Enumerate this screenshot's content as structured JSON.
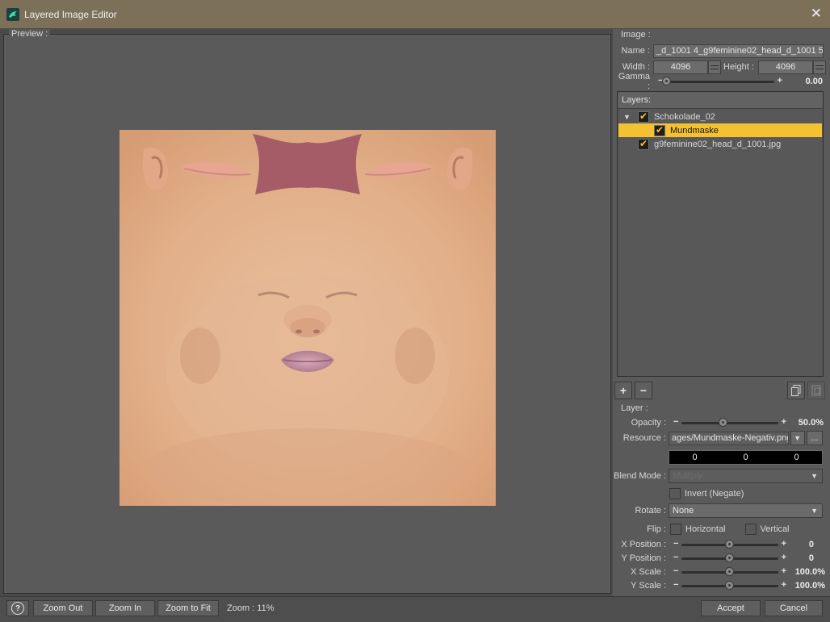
{
  "window": {
    "title": "Layered Image Editor",
    "close_symbol": "✕",
    "app_icon": "daz-dragon-icon"
  },
  "preview": {
    "label": "Preview :"
  },
  "image": {
    "section_label": "Image :",
    "name_label": "Name :",
    "name_value": "_d_1001 4_g9feminine02_head_d_1001 5",
    "width_label": "Width :",
    "width_value": "4096",
    "height_label": "Height :",
    "height_value": "4096",
    "gamma_label": "Gamma :",
    "gamma_value": "0.00",
    "gamma_level": 0.0
  },
  "layers": {
    "header": "Layers:",
    "items": [
      {
        "name": "Schokolade_02",
        "checked": true,
        "expanded": true,
        "indent": 0,
        "selected": false
      },
      {
        "name": "Mundmaske",
        "checked": true,
        "indent": 1,
        "selected": true
      },
      {
        "name": "g9feminine02_head_d_1001.jpg",
        "checked": true,
        "indent": 0,
        "selected": false
      }
    ],
    "add_symbol": "+",
    "remove_symbol": "−"
  },
  "layer": {
    "section_label": "Layer :",
    "opacity_label": "Opacity :",
    "opacity_value": "50.0%",
    "opacity_level": 0.5,
    "resource_label": "Resource :",
    "resource_value": "ages/Mundmaske-Negativ.png",
    "resource_browse": "...",
    "color_values": [
      "0",
      "0",
      "0"
    ],
    "blend_label": "Blend Mode :",
    "blend_value": "Multiply",
    "invert_label": "Invert (Negate)",
    "rotate_label": "Rotate :",
    "rotate_value": "None",
    "flip_label": "Flip :",
    "flip_horizontal": "Horizontal",
    "flip_vertical": "Vertical",
    "xpos_label": "X Position :",
    "xpos_value": "0",
    "ypos_label": "Y Position :",
    "ypos_value": "0",
    "xscale_label": "X Scale :",
    "xscale_value": "100.0%",
    "yscale_label": "Y Scale :",
    "yscale_value": "100.0%"
  },
  "bottom": {
    "help_symbol": "?",
    "zoom_out": "Zoom Out",
    "zoom_in": "Zoom In",
    "zoom_fit": "Zoom to Fit",
    "zoom_status": "Zoom : 11%",
    "accept": "Accept",
    "cancel": "Cancel"
  },
  "colors": {
    "accent": "#f3c132",
    "titlebar": "#7d7059",
    "panel": "#5a5a5a"
  }
}
